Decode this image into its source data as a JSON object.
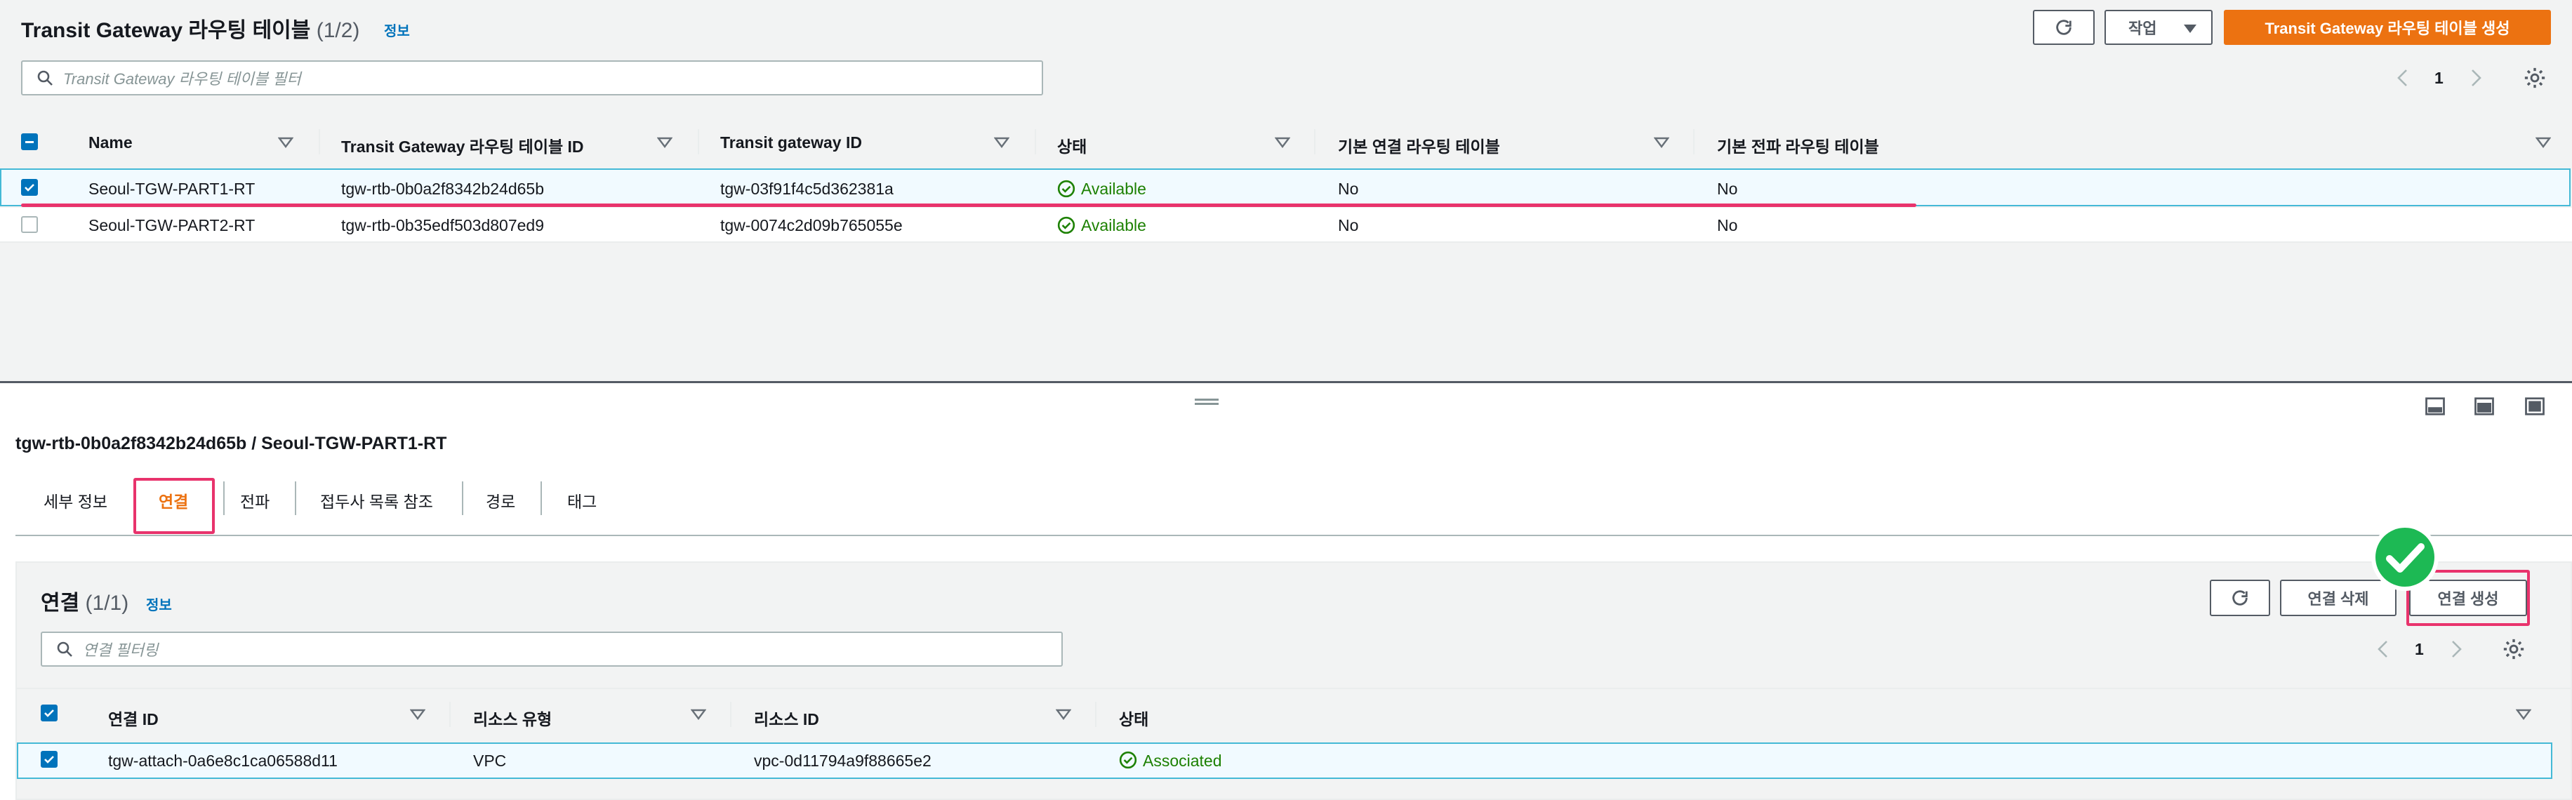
{
  "top": {
    "title": "Transit Gateway 라우팅 테이블",
    "count": "(1/2)",
    "info": "정보",
    "actions_label": "작업",
    "create_label": "Transit Gateway 라우팅 테이블 생성",
    "search_placeholder": "Transit Gateway 라우팅 테이블 필터",
    "page": "1",
    "columns": [
      "Name",
      "Transit Gateway 라우팅 테이블 ID",
      "Transit gateway ID",
      "상태",
      "기본 연결 라우팅 테이블",
      "기본 전파 라우팅 테이블"
    ],
    "rows": [
      {
        "selected": true,
        "name": "Seoul-TGW-PART1-RT",
        "rtb_id": "tgw-rtb-0b0a2f8342b24d65b",
        "tgw_id": "tgw-03f91f4c5d362381a",
        "status": "Available",
        "default_assoc": "No",
        "default_prop": "No"
      },
      {
        "selected": false,
        "name": "Seoul-TGW-PART2-RT",
        "rtb_id": "tgw-rtb-0b35edf503d807ed9",
        "tgw_id": "tgw-0074c2d09b765055e",
        "status": "Available",
        "default_assoc": "No",
        "default_prop": "No"
      }
    ]
  },
  "detail": {
    "heading": "tgw-rtb-0b0a2f8342b24d65b / Seoul-TGW-PART1-RT",
    "tabs": [
      "세부 정보",
      "연결",
      "전파",
      "접두사 목록 참조",
      "경로",
      "태그"
    ],
    "active_tab": "연결"
  },
  "assoc": {
    "title": "연결",
    "count": "(1/1)",
    "info": "정보",
    "delete_label": "연결 삭제",
    "create_label": "연결 생성",
    "search_placeholder": "연결 필터링",
    "page": "1",
    "columns": [
      "연결 ID",
      "리소스 유형",
      "리소스 ID",
      "상태"
    ],
    "rows": [
      {
        "selected": true,
        "attach_id": "tgw-attach-0a6e8c1ca06588d11",
        "resource_type": "VPC",
        "resource_id": "vpc-0d11794a9f88665e2",
        "status": "Associated"
      }
    ]
  },
  "colors": {
    "accent": "#ec7211",
    "link": "#0073bb",
    "success": "#1d8102",
    "highlight": "#e8336c",
    "check_badge": "#1db954"
  }
}
